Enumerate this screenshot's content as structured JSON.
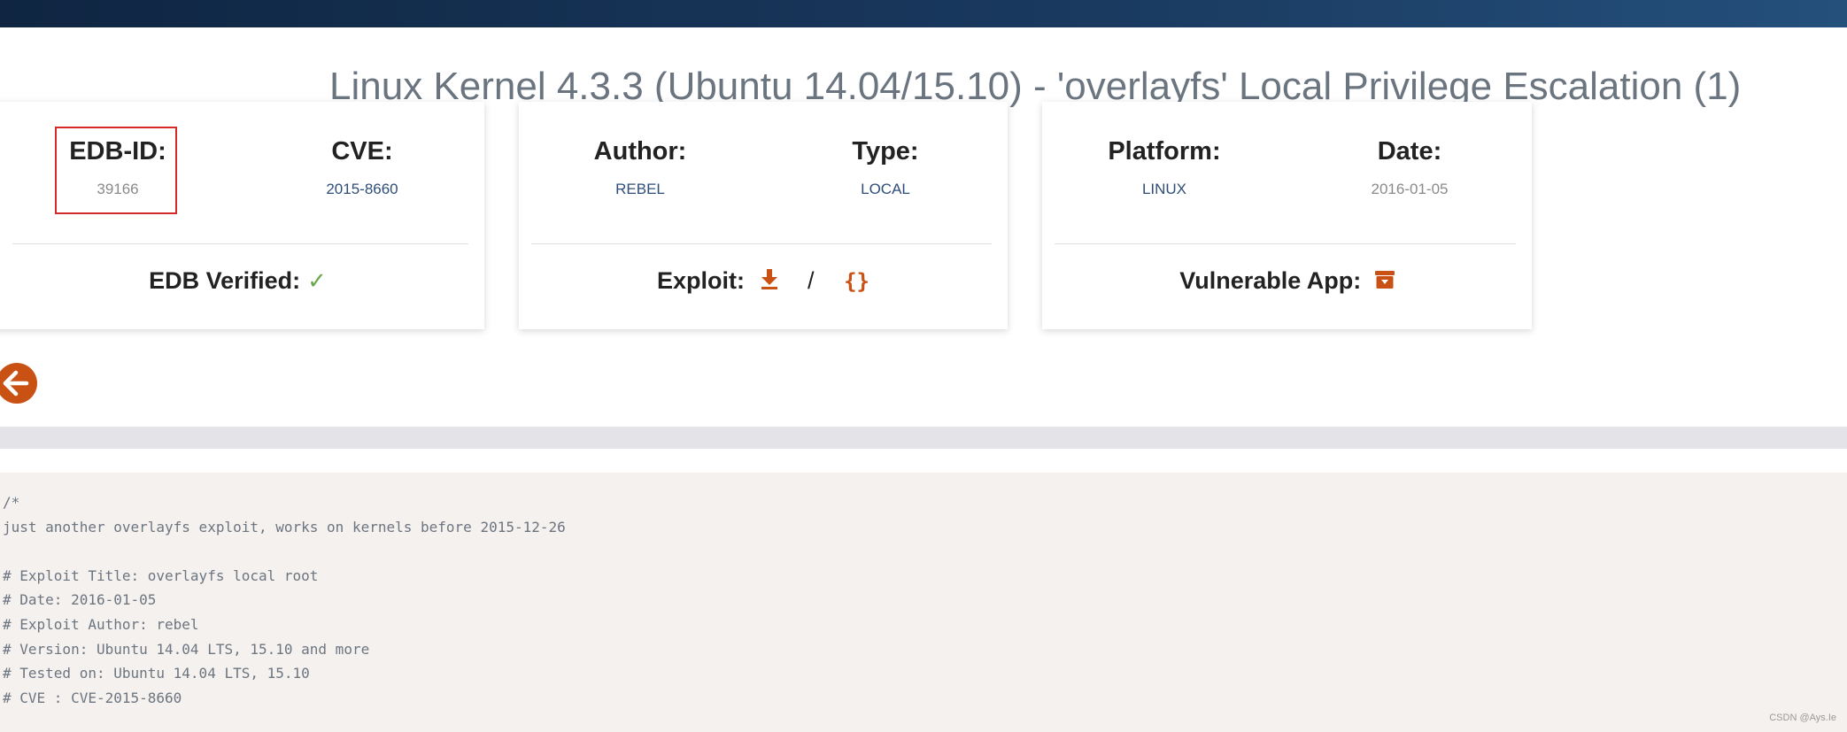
{
  "title": "Linux Kernel 4.3.3 (Ubuntu 14.04/15.10) - 'overlayfs' Local Privilege Escalation (1)",
  "card1": {
    "edb_id_label": "EDB-ID:",
    "edb_id_value": "39166",
    "cve_label": "CVE:",
    "cve_value": "2015-8660",
    "verified_label": "EDB Verified:",
    "verified_icon": "check-icon"
  },
  "card2": {
    "author_label": "Author:",
    "author_value": "REBEL",
    "type_label": "Type:",
    "type_value": "LOCAL",
    "exploit_label": "Exploit:",
    "exploit_separator": "/",
    "download_icon": "download-icon",
    "code_icon": "code-braces-icon",
    "code_glyph": "{}"
  },
  "card3": {
    "platform_label": "Platform:",
    "platform_value": "LINUX",
    "date_label": "Date:",
    "date_value": "2016-01-05",
    "vuln_app_label": "Vulnerable App:",
    "vuln_app_icon": "archive-download-icon"
  },
  "back_button_icon": "arrow-left-icon",
  "code_text": "/*\njust another overlayfs exploit, works on kernels before 2015-12-26\n\n# Exploit Title: overlayfs local root\n# Date: 2016-01-05\n# Exploit Author: rebel\n# Version: Ubuntu 14.04 LTS, 15.10 and more\n# Tested on: Ubuntu 14.04 LTS, 15.10\n# CVE : CVE-2015-8660",
  "watermark": "CSDN @Ays.Ie",
  "colors": {
    "accent": "#c95114",
    "link": "#2e4e78",
    "verified": "#6aa84f",
    "highlight_box": "#d42a2a",
    "header_bar": "#0f2542"
  }
}
